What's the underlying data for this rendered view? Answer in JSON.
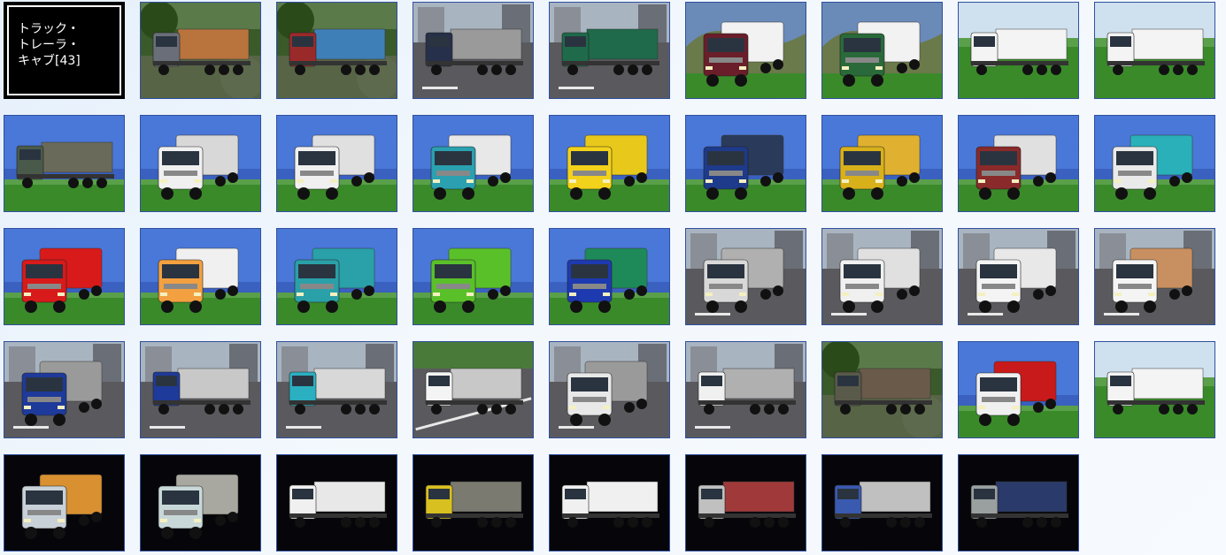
{
  "title": {
    "line1": "トラック・",
    "line2": "トレーラ・",
    "line3": "キャブ[43]"
  },
  "tiles": [
    {
      "icon": "flatbed-truck-forest-icon",
      "bg": "forest",
      "cab": "#6a6e78",
      "cargo": "#b8743c",
      "view": "side"
    },
    {
      "icon": "covered-truck-forest-icon",
      "bg": "forest",
      "cab": "#9a2a2a",
      "cargo": "#3f7fb8",
      "view": "side"
    },
    {
      "icon": "flatbed-truck-city-icon",
      "bg": "city",
      "cab": "#26304a",
      "cargo": "#9a9a9a",
      "view": "side"
    },
    {
      "icon": "dump-truck-city-icon",
      "bg": "city",
      "cab": "#1e6a4a",
      "cargo": "#1e6a4a",
      "view": "side"
    },
    {
      "icon": "box-truck-icon",
      "bg": "hills",
      "cab": "#6a1e2a",
      "cargo": "#f2f2f2",
      "view": "front"
    },
    {
      "icon": "box-truck-icon",
      "bg": "hills",
      "cab": "#2a6a3a",
      "cargo": "#f2f2f2",
      "view": "front"
    },
    {
      "icon": "trailer-truck-icon",
      "bg": "field",
      "cab": "#f4f4f4",
      "cargo": "#f4f4f4",
      "view": "side"
    },
    {
      "icon": "trailer-truck-icon",
      "bg": "field",
      "cab": "#f4f4f4",
      "cargo": "#f4f4f4",
      "view": "side"
    },
    {
      "icon": "flatbed-truck-icon",
      "bg": "sky",
      "cab": "#4a5a4a",
      "cargo": "#6a6a5a",
      "view": "side"
    },
    {
      "icon": "box-truck-icon",
      "bg": "sky",
      "cab": "#f0f0f0",
      "cargo": "#d8d8d8",
      "view": "front"
    },
    {
      "icon": "dump-truck-icon",
      "bg": "sky",
      "cab": "#f0f0f0",
      "cargo": "#e0e0e0",
      "view": "front"
    },
    {
      "icon": "flatbed-truck-icon",
      "bg": "sky",
      "cab": "#2aa0b0",
      "cargo": "#e8e8e8",
      "view": "front"
    },
    {
      "icon": "tanker-truck-icon",
      "bg": "sky",
      "cab": "#f2d21a",
      "cargo": "#e8c81a",
      "view": "front"
    },
    {
      "icon": "dump-truck-icon",
      "bg": "sky",
      "cab": "#1e3a8a",
      "cargo": "#2a3a5a",
      "view": "front"
    },
    {
      "icon": "box-truck-icon",
      "bg": "sky",
      "cab": "#d8b01a",
      "cargo": "#e0b030",
      "view": "front"
    },
    {
      "icon": "flatbed-truck-icon",
      "bg": "sky",
      "cab": "#8a2a2a",
      "cargo": "#e0e0e0",
      "view": "front"
    },
    {
      "icon": "box-truck-icon",
      "bg": "sky",
      "cab": "#eaeaea",
      "cargo": "#2ab0b8",
      "view": "front"
    },
    {
      "icon": "box-truck-icon",
      "bg": "sky",
      "cab": "#d81a1a",
      "cargo": "#d81a1a",
      "view": "front"
    },
    {
      "icon": "dump-truck-icon",
      "bg": "sky",
      "cab": "#f2a040",
      "cargo": "#f0f0f0",
      "view": "front"
    },
    {
      "icon": "flatbed-truck-icon",
      "bg": "sky",
      "cab": "#2aa0a8",
      "cargo": "#2aa0a8",
      "view": "front"
    },
    {
      "icon": "flatbed-truck-icon",
      "bg": "sky",
      "cab": "#5ac02a",
      "cargo": "#5ac02a",
      "view": "front"
    },
    {
      "icon": "flatbed-truck-icon",
      "bg": "sky",
      "cab": "#1e3ab0",
      "cargo": "#1e8a5a",
      "view": "front"
    },
    {
      "icon": "flatbed-truck-city-icon",
      "bg": "city",
      "cab": "#d8d8d8",
      "cargo": "#b0b0b0",
      "view": "front"
    },
    {
      "icon": "box-truck-city-icon",
      "bg": "city",
      "cab": "#f0f0f0",
      "cargo": "#e0e0e0",
      "view": "front"
    },
    {
      "icon": "pickup-truck-icon",
      "bg": "city",
      "cab": "#f4f4f4",
      "cargo": "#e8e8e8",
      "view": "front"
    },
    {
      "icon": "pickup-truck-icon",
      "bg": "city",
      "cab": "#f4f4f4",
      "cargo": "#c89060",
      "view": "front"
    },
    {
      "icon": "box-truck-city-icon",
      "bg": "city",
      "cab": "#1e3a9a",
      "cargo": "#9a9a9a",
      "view": "front"
    },
    {
      "icon": "trailer-truck-city-icon",
      "bg": "city",
      "cab": "#1e3a9a",
      "cargo": "#c8c8c8",
      "view": "side"
    },
    {
      "icon": "trailer-truck-city-icon",
      "bg": "city",
      "cab": "#2ab0c0",
      "cargo": "#d8d8d8",
      "view": "side"
    },
    {
      "icon": "tow-truck-icon",
      "bg": "road",
      "cab": "#f4f4f4",
      "cargo": "#c8c8c8",
      "view": "side"
    },
    {
      "icon": "box-truck-city-icon",
      "bg": "city",
      "cab": "#e8e8e8",
      "cargo": "#9a9a9a",
      "view": "front"
    },
    {
      "icon": "flatbed-truck-city-icon",
      "bg": "city",
      "cab": "#f0f0f0",
      "cargo": "#b0b0b0",
      "view": "side"
    },
    {
      "icon": "dump-truck-forest-icon",
      "bg": "forest",
      "cab": "#5a5a4a",
      "cargo": "#6a5a4a",
      "view": "side"
    },
    {
      "icon": "tractor-head-icon",
      "bg": "sky",
      "cab": "#f0f0f0",
      "cargo": "#c81a1a",
      "view": "front"
    },
    {
      "icon": "low-bed-trailer-icon",
      "bg": "field",
      "cab": "#f4f4f4",
      "cargo": "#f4f4f4",
      "view": "side"
    },
    {
      "icon": "box-truck-dark-icon",
      "bg": "dark",
      "cab": "#c8d0d8",
      "cargo": "#d89030",
      "view": "front"
    },
    {
      "icon": "box-truck-dark-icon",
      "bg": "dark",
      "cab": "#c8d8d8",
      "cargo": "#a8a8a0",
      "view": "front"
    },
    {
      "icon": "trailer-truck-dark-icon",
      "bg": "dark",
      "cab": "#f0f0f0",
      "cargo": "#e8e8e8",
      "view": "side"
    },
    {
      "icon": "trailer-truck-dark-icon",
      "bg": "dark",
      "cab": "#d8c020",
      "cargo": "#7a7a70",
      "view": "side"
    },
    {
      "icon": "trailer-truck-dark-icon",
      "bg": "dark",
      "cab": "#f0f0f0",
      "cargo": "#f0f0f0",
      "view": "side"
    },
    {
      "icon": "trailer-truck-dark-icon",
      "bg": "dark",
      "cab": "#c0c0c0",
      "cargo": "#a03a3a",
      "view": "side"
    },
    {
      "icon": "trailer-truck-dark-icon",
      "bg": "dark",
      "cab": "#3a5ab0",
      "cargo": "#c0c0c0",
      "view": "side"
    },
    {
      "icon": "trailer-truck-dark-icon",
      "bg": "dark",
      "cab": "#9aa0a0",
      "cargo": "#2a3a6a",
      "view": "side"
    }
  ]
}
